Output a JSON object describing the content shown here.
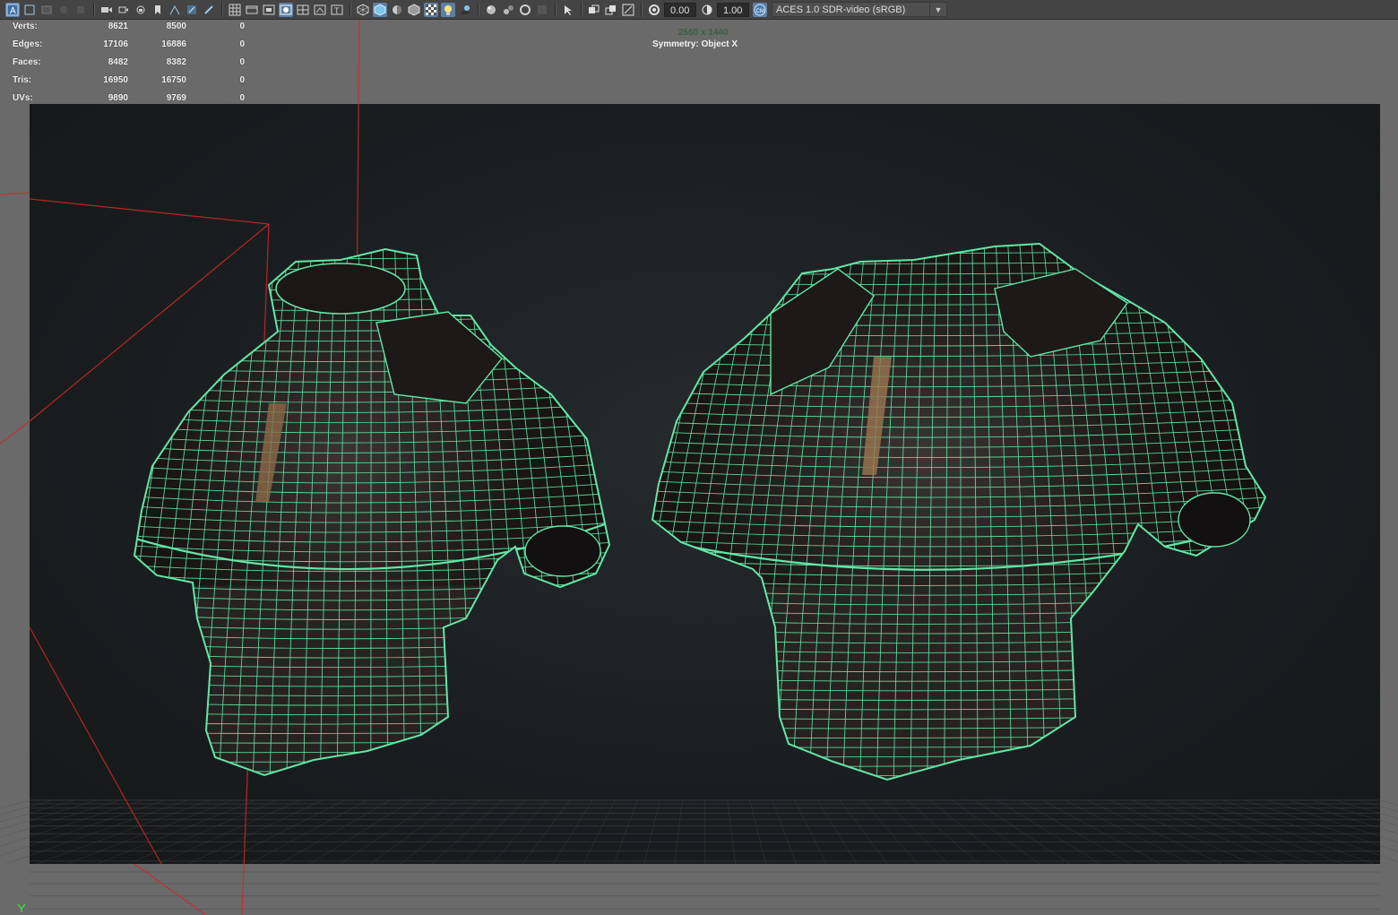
{
  "toolbar": {
    "exposure_value": "0.00",
    "gamma_value": "1.00",
    "color_space": "ACES 1.0 SDR-video (sRGB)",
    "icons": [
      "select-mode-icon",
      "lasso-icon",
      "paint-icon",
      "camera-icon",
      "camera-attr-icon",
      "bookmark-icon",
      "grid-icon",
      "film-gate-icon",
      "resolution-gate-icon",
      "safe-action-icon",
      "field-chart-icon",
      "wireframe-icon",
      "smooth-shade-icon",
      "default-material-icon",
      "textured-icon",
      "lights-icon",
      "shadows-icon",
      "xray-icon",
      "isolate-icon",
      "exposure-icon",
      "gamma-icon",
      "color-management-icon"
    ]
  },
  "hud": {
    "rows": [
      {
        "label": "Verts:",
        "v1": "8621",
        "v2": "8500",
        "v3": "0"
      },
      {
        "label": "Edges:",
        "v1": "17106",
        "v2": "16886",
        "v3": "0"
      },
      {
        "label": "Faces:",
        "v1": "8482",
        "v2": "8382",
        "v3": "0"
      },
      {
        "label": "Tris:",
        "v1": "16950",
        "v2": "16750",
        "v3": "0"
      },
      {
        "label": "UVs:",
        "v1": "9890",
        "v2": "9769",
        "v3": "0"
      }
    ],
    "resolution": "2560 x 1440",
    "symmetry": "Symmetry: Object X"
  },
  "viewport": {
    "wire_color": "#62e6a6",
    "background_color": "#1c2022",
    "frame_color": "#6a6a6a",
    "axis_line_color": "#d22828",
    "objects": [
      "armor-model-left",
      "armor-model-right"
    ]
  }
}
